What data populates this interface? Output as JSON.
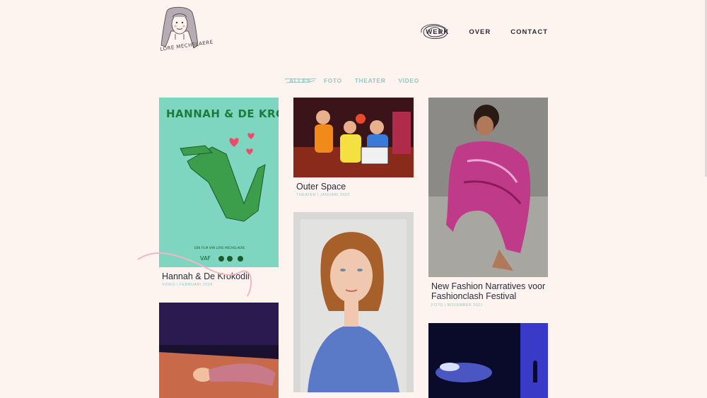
{
  "header": {
    "logo_caption": "LORE MECHELAERE",
    "nav": [
      {
        "label": "WERK"
      },
      {
        "label": "OVER"
      },
      {
        "label": "CONTACT"
      }
    ]
  },
  "filters": [
    {
      "label": "ALLES",
      "active": true
    },
    {
      "label": "FOTO"
    },
    {
      "label": "THEATER"
    },
    {
      "label": "VIDEO"
    }
  ],
  "poster": {
    "title": "HANNAH & DE KROKODIL",
    "credit": "EEN FILM VAN LORE MECHELAERE",
    "logos": "VAF"
  },
  "cards": [
    {
      "title": "Hannah & De Krokodil",
      "meta": "VIDEO | FEBRUARI 2024"
    },
    {
      "title": "Outer Space",
      "meta": "THEATER | JANUARI 2022"
    },
    {
      "title_line1": "New Fashion Narratives voor",
      "title_line2": "Fashionclash Festival",
      "meta": "FOTO | NOVEMBER 2021"
    }
  ],
  "colors": {
    "background": "#fdf4f0",
    "accent": "#8fc9c6",
    "text": "#2a2a3a",
    "poster_bg": "#7fd6c0",
    "croc_green": "#3c9e4a"
  }
}
